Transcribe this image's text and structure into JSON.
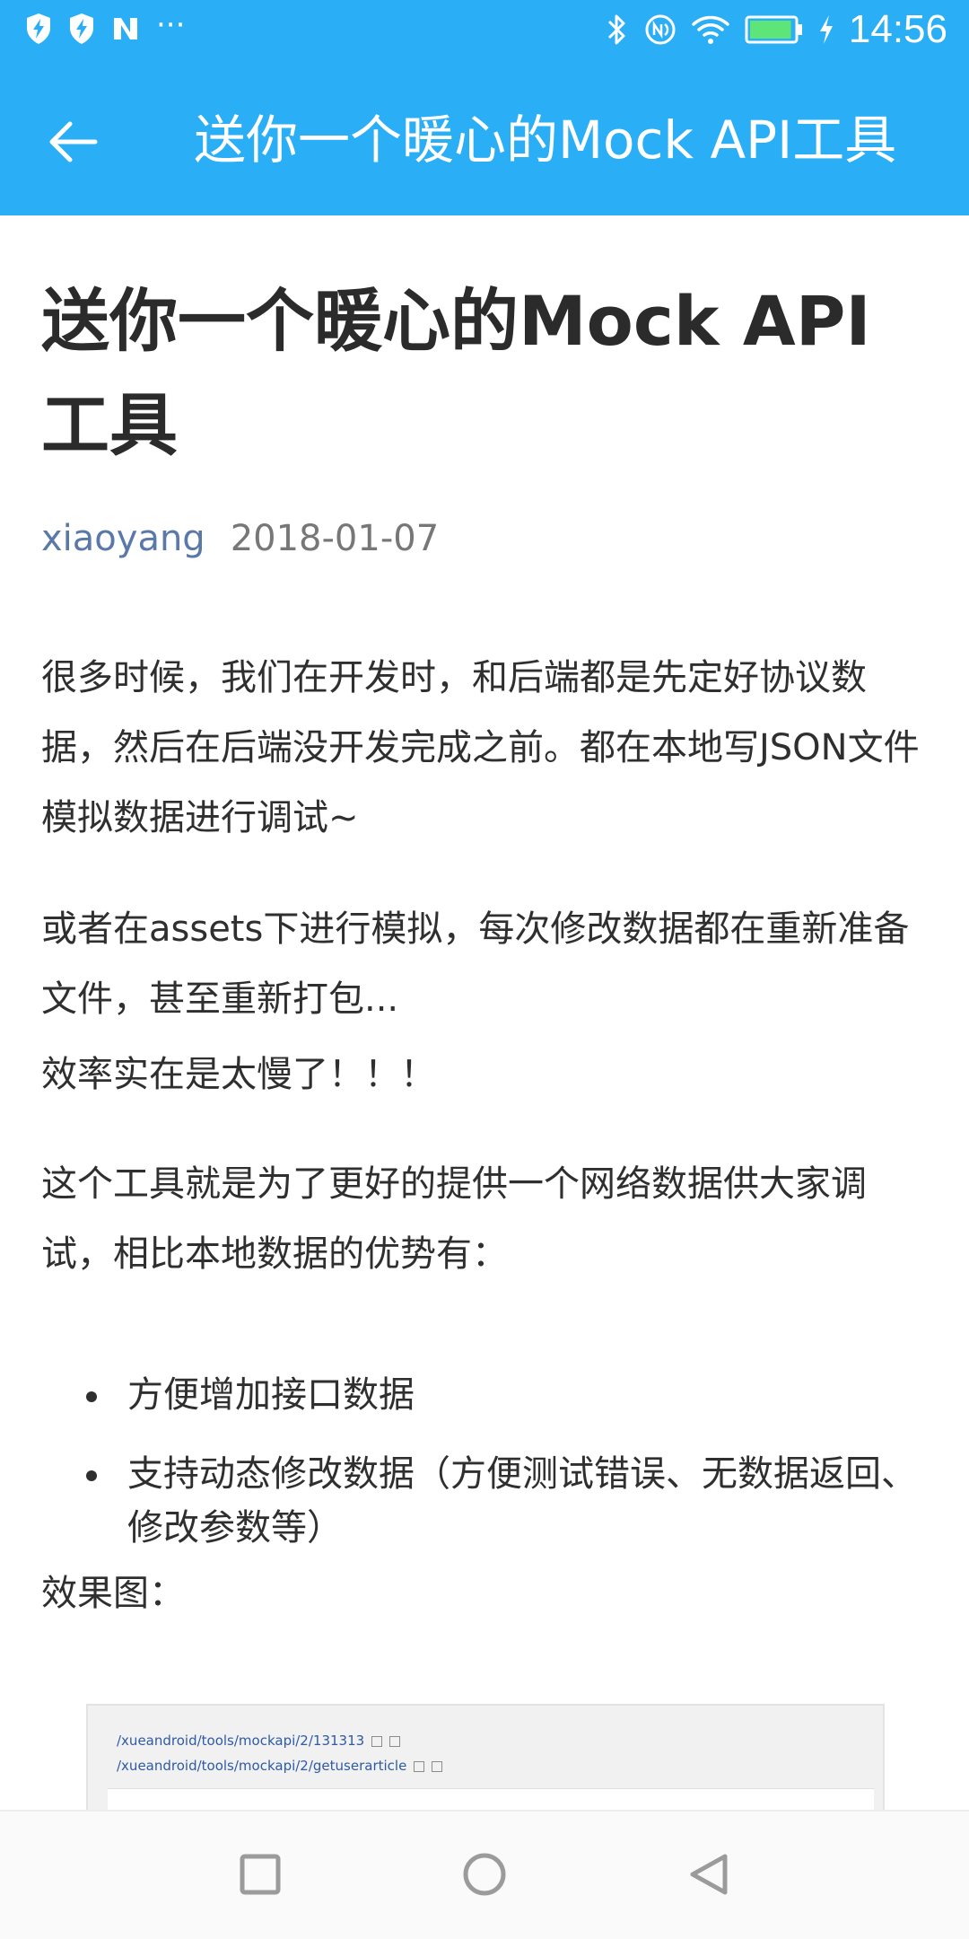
{
  "status_bar": {
    "time": "14:56",
    "left_icons": [
      "shield-bolt-icon",
      "shield-bolt-icon",
      "n-logo-icon",
      "more-dots-icon"
    ],
    "more": "···",
    "right_icons": [
      "bluetooth-icon",
      "nfc-icon",
      "wifi-icon",
      "battery-icon",
      "charging-icon"
    ],
    "battery_level": 0.95,
    "battery_color": "#5de57a"
  },
  "app_bar": {
    "title": "送你一个暖心的Mock API工具",
    "background": "#2aaef5"
  },
  "article": {
    "title": "送你一个暖心的Mock API工具",
    "author": "xiaoyang",
    "date": "2018-01-07",
    "paragraphs": [
      "很多时候，我们在开发时，和后端都是先定好协议数据，然后在后端没开发完成之前。都在本地写JSON文件模拟数据进行调试~",
      "或者在assets下进行模拟，每次修改数据都在重新准备文件，甚至重新打包...",
      "效率实在是太慢了！！！",
      "这个工具就是为了更好的提供一个网络数据供大家调试，相比本地数据的优势有：",
      "效果图："
    ],
    "bullets": [
      "方便增加接口数据",
      "支持动态修改数据（方便测试错误、无数据返回、修改参数等）"
    ],
    "preview_lines": [
      "/xueandroid/tools/mockapi/2/131313",
      "/xueandroid/tools/mockapi/2/getuserarticle"
    ]
  },
  "nav_bar": {
    "buttons": [
      "recents-square-icon",
      "home-circle-icon",
      "back-triangle-icon"
    ]
  }
}
